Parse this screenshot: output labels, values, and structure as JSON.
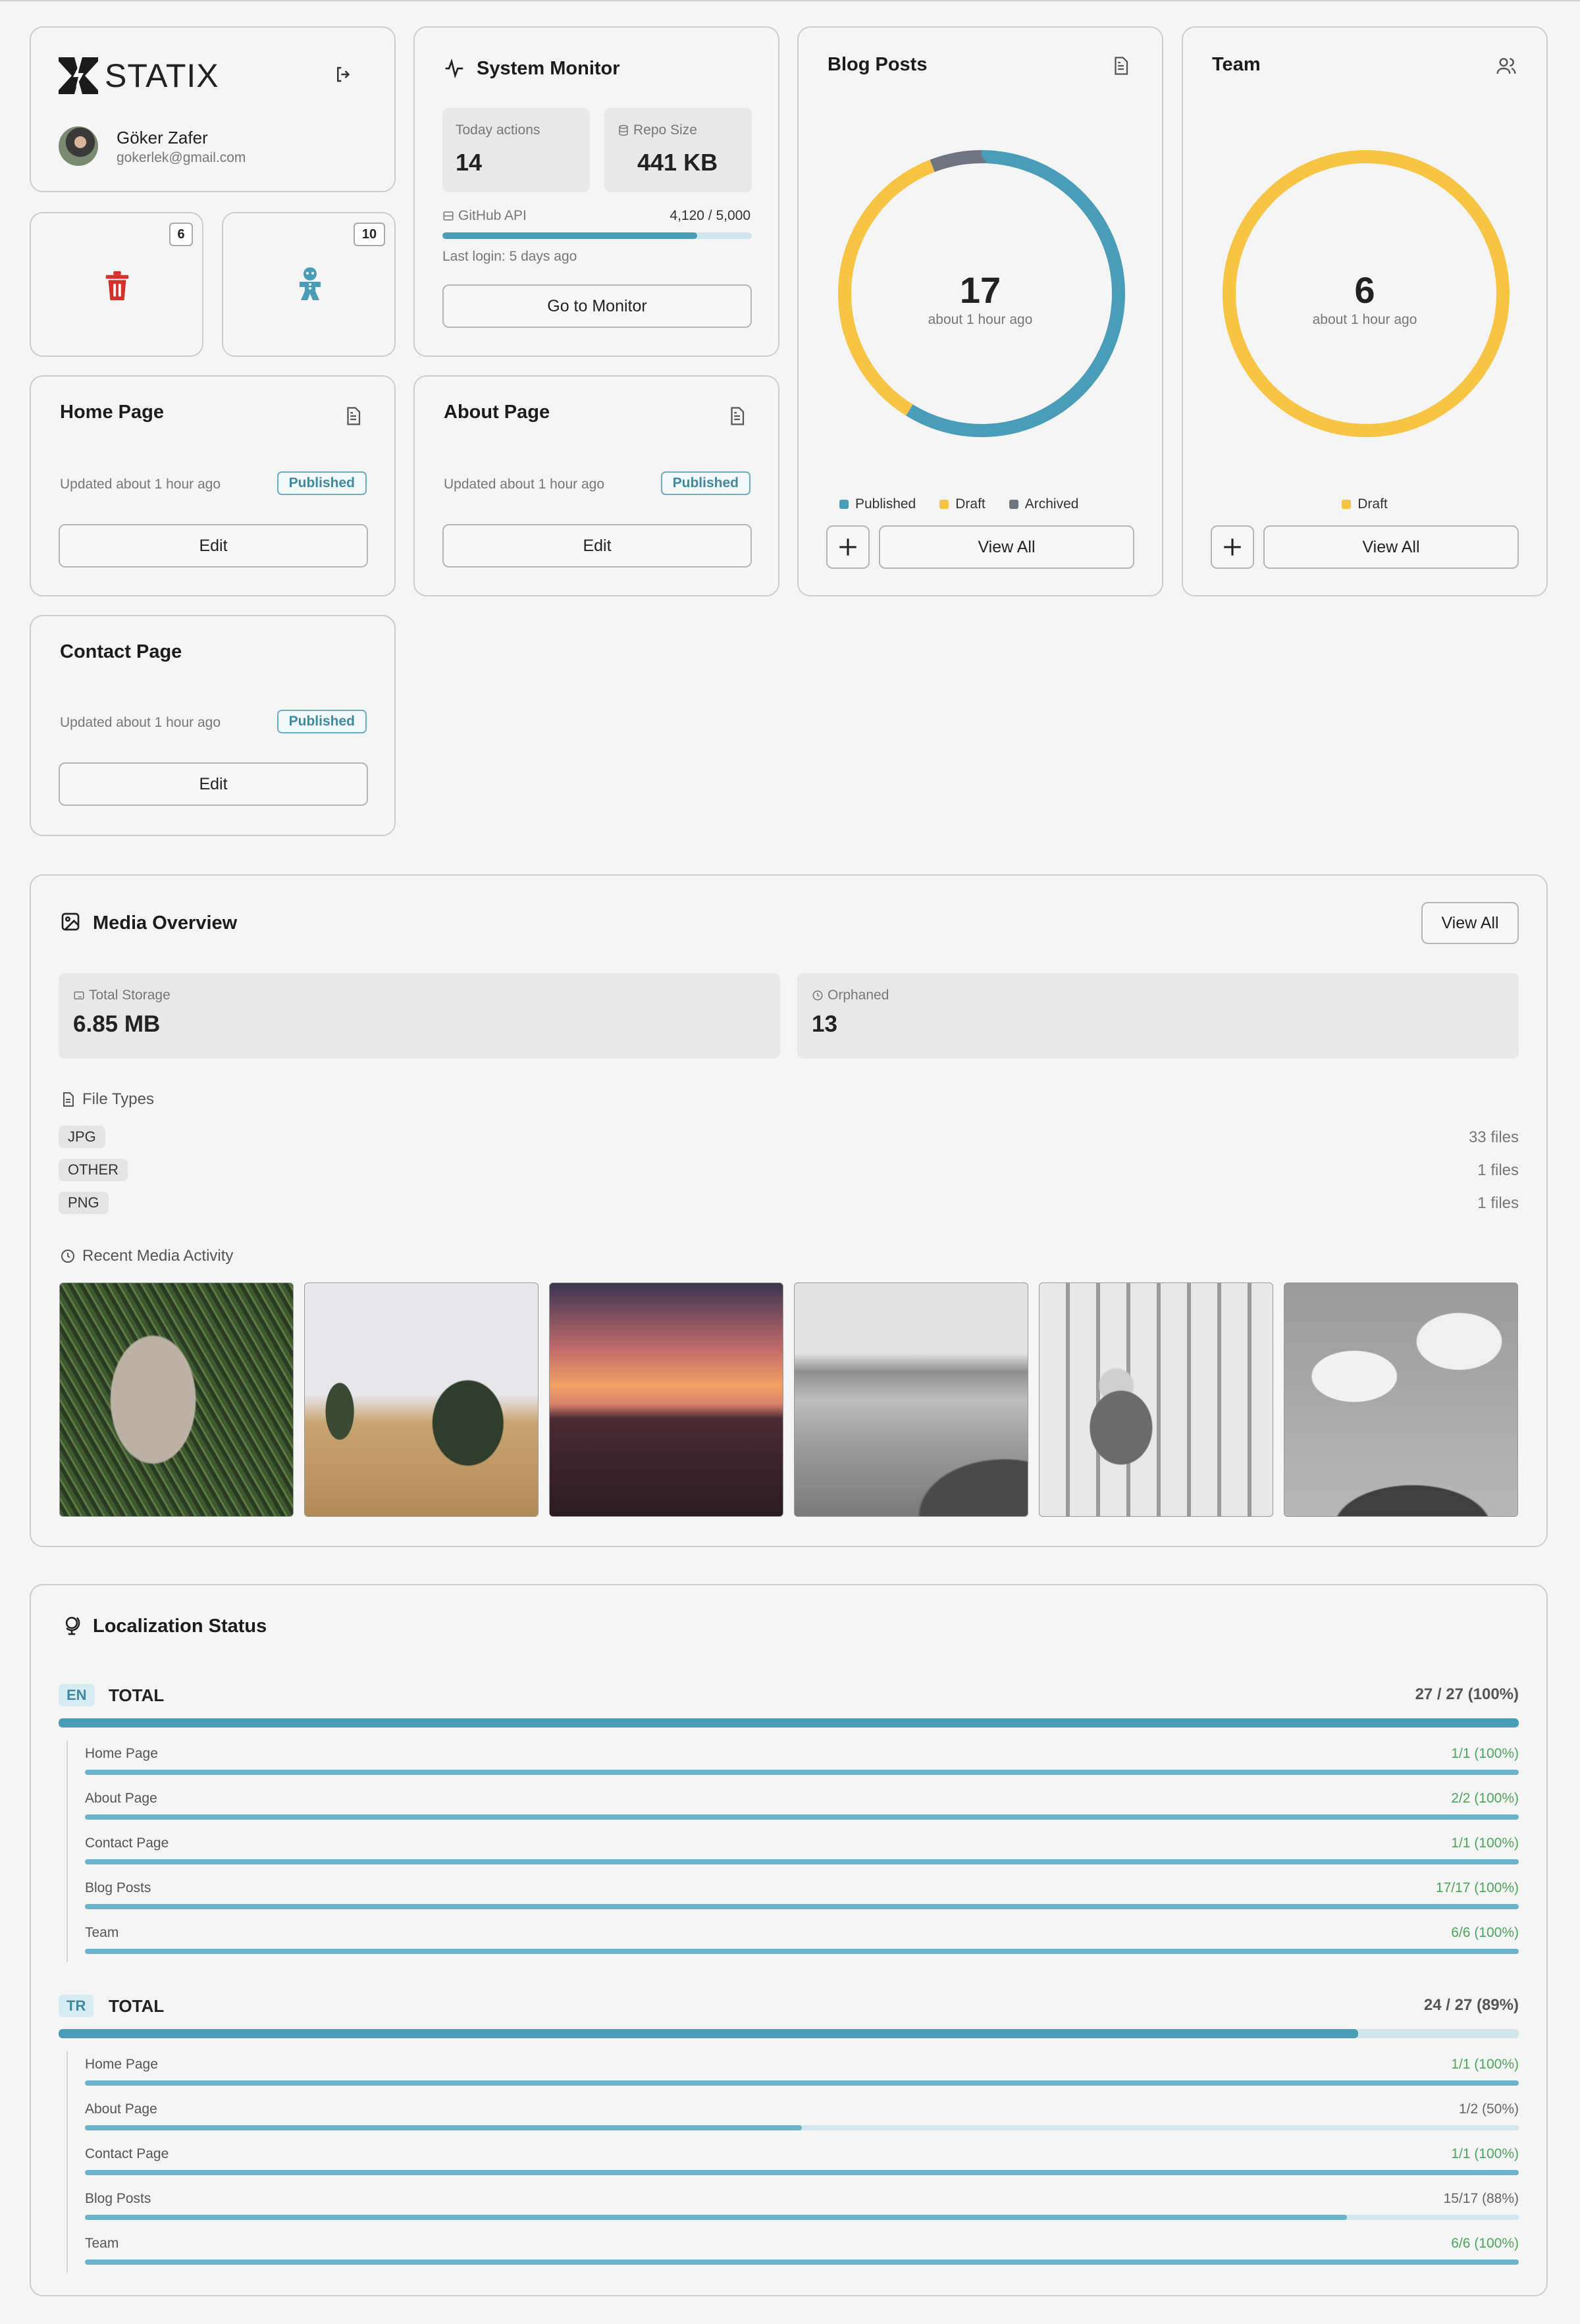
{
  "profile": {
    "logo": "STATIX",
    "name": "Göker Zafer",
    "email": "gokerlek@gmail.com"
  },
  "quick": {
    "trash_count": "6",
    "bug_count": "10"
  },
  "monitor": {
    "title": "System Monitor",
    "today_label": "Today actions",
    "today_value": "14",
    "repo_label": "Repo Size",
    "repo_value": "441 KB",
    "api_label": "GitHub API",
    "api_value": "4,120 / 5,000",
    "api_fraction": 0.824,
    "last_login": "Last login: 5 days ago",
    "button": "Go to Monitor"
  },
  "blog": {
    "title": "Blog Posts",
    "count": "17",
    "time": "about 1 hour ago",
    "legend": [
      "Published",
      "Draft",
      "Archived"
    ],
    "view_all": "View All",
    "values": [
      10,
      6,
      1
    ],
    "colors": [
      "#4a9db8",
      "#f8c443",
      "#6e7480"
    ]
  },
  "team": {
    "title": "Team",
    "count": "6",
    "time": "about 1 hour ago",
    "legend": [
      "Draft"
    ],
    "view_all": "View All",
    "values": [
      6
    ],
    "colors": [
      "#f8c443"
    ]
  },
  "pages": [
    {
      "title": "Home Page",
      "updated": "Updated about 1 hour ago",
      "status": "Published",
      "edit": "Edit"
    },
    {
      "title": "About Page",
      "updated": "Updated about 1 hour ago",
      "status": "Published",
      "edit": "Edit"
    },
    {
      "title": "Contact Page",
      "updated": "Updated about 1 hour ago",
      "status": "Published",
      "edit": "Edit"
    }
  ],
  "media": {
    "title": "Media Overview",
    "view_all": "View All",
    "storage_label": "Total Storage",
    "storage_value": "6.85 MB",
    "orphaned_label": "Orphaned",
    "orphaned_value": "13",
    "file_types_label": "File Types",
    "types": [
      {
        "name": "JPG",
        "count": "33 files"
      },
      {
        "name": "OTHER",
        "count": "1 files"
      },
      {
        "name": "PNG",
        "count": "1 files"
      }
    ],
    "recent_label": "Recent Media Activity"
  },
  "loc": {
    "title": "Localization Status",
    "groups": [
      {
        "lang": "EN",
        "label": "TOTAL",
        "value": "27 / 27 (100%)",
        "fraction": 1.0,
        "items": [
          {
            "name": "Home Page",
            "value": "1/1 (100%)",
            "fraction": 1.0
          },
          {
            "name": "About Page",
            "value": "2/2 (100%)",
            "fraction": 1.0
          },
          {
            "name": "Contact Page",
            "value": "1/1 (100%)",
            "fraction": 1.0
          },
          {
            "name": "Blog Posts",
            "value": "17/17 (100%)",
            "fraction": 1.0
          },
          {
            "name": "Team",
            "value": "6/6 (100%)",
            "fraction": 1.0
          }
        ]
      },
      {
        "lang": "TR",
        "label": "TOTAL",
        "value": "24 / 27 (89%)",
        "fraction": 0.89,
        "items": [
          {
            "name": "Home Page",
            "value": "1/1 (100%)",
            "fraction": 1.0
          },
          {
            "name": "About Page",
            "value": "1/2 (50%)",
            "fraction": 0.5
          },
          {
            "name": "Contact Page",
            "value": "1/1 (100%)",
            "fraction": 1.0
          },
          {
            "name": "Blog Posts",
            "value": "15/17 (88%)",
            "fraction": 0.88
          },
          {
            "name": "Team",
            "value": "6/6 (100%)",
            "fraction": 1.0
          }
        ]
      }
    ]
  }
}
